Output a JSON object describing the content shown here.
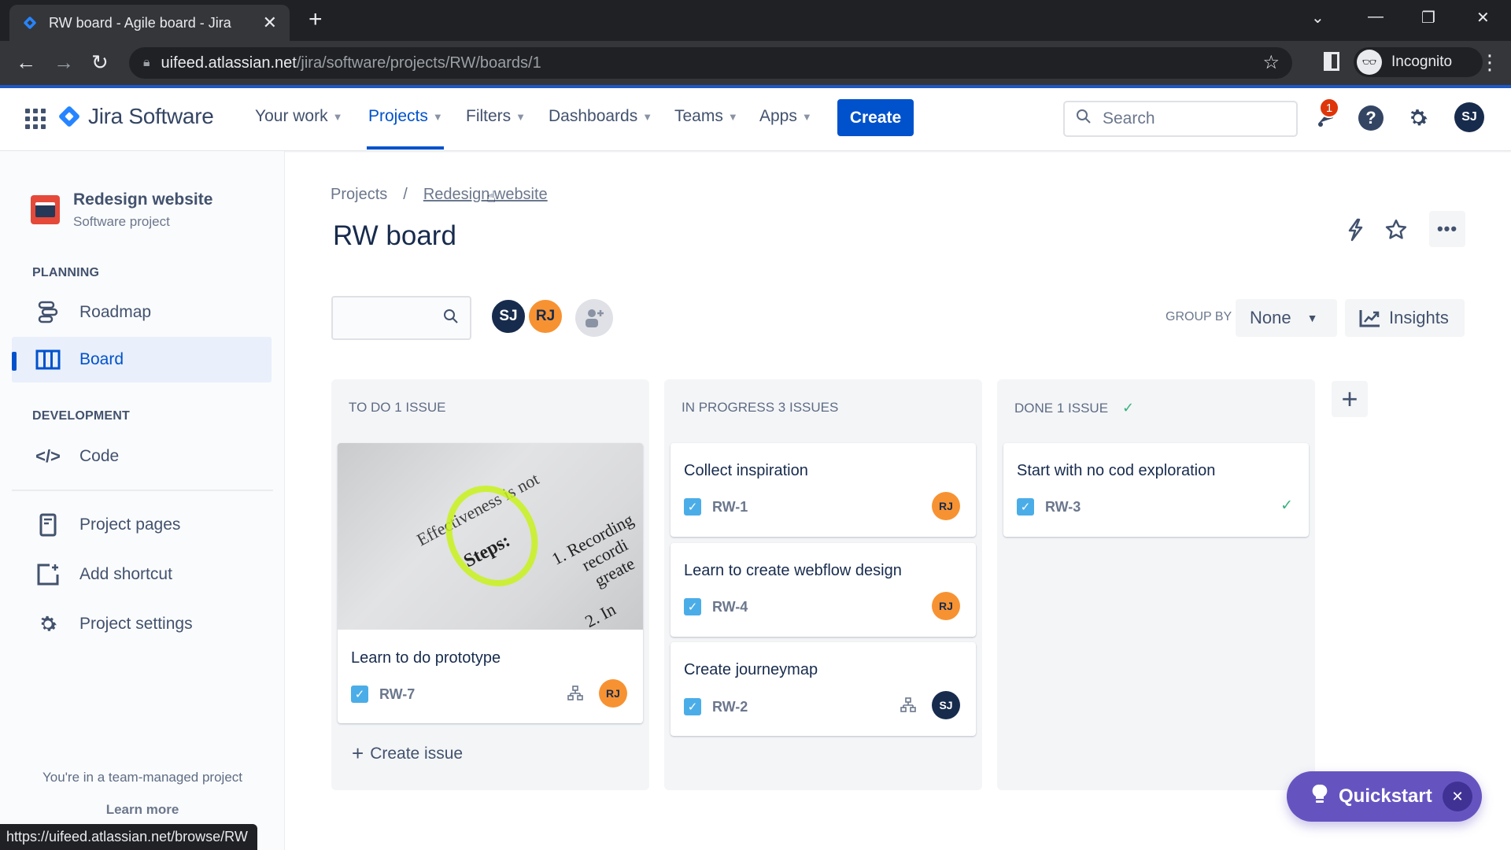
{
  "browser": {
    "tab_title": "RW board - Agile board - Jira",
    "url_host": "uifeed.atlassian.net",
    "url_path": "/jira/software/projects/RW/boards/1",
    "profile_label": "Incognito",
    "status_url": "https://uifeed.atlassian.net/browse/RW"
  },
  "topnav": {
    "product": "Jira Software",
    "items": [
      {
        "label": "Your work",
        "active": false
      },
      {
        "label": "Projects",
        "active": true
      },
      {
        "label": "Filters",
        "active": false
      },
      {
        "label": "Dashboards",
        "active": false
      },
      {
        "label": "Teams",
        "active": false
      },
      {
        "label": "Apps",
        "active": false
      }
    ],
    "create_label": "Create",
    "search_placeholder": "Search",
    "notification_count": "1",
    "user_initials": "SJ"
  },
  "sidebar": {
    "project_name": "Redesign website",
    "project_type": "Software project",
    "planning_heading": "PLANNING",
    "development_heading": "DEVELOPMENT",
    "items": [
      {
        "label": "Roadmap",
        "icon": "roadmap-icon"
      },
      {
        "label": "Board",
        "icon": "board-icon",
        "active": true
      },
      {
        "label": "Code",
        "icon": "code-icon"
      },
      {
        "label": "Project pages",
        "icon": "pages-icon"
      },
      {
        "label": "Add shortcut",
        "icon": "add-shortcut-icon"
      },
      {
        "label": "Project settings",
        "icon": "settings-icon"
      }
    ],
    "team_note": "You're in a team-managed project",
    "learn_more": "Learn more"
  },
  "main": {
    "breadcrumb": [
      "Projects",
      "Redesign website"
    ],
    "title": "RW board",
    "board_search_placeholder": "",
    "avatars": [
      "SJ",
      "RJ"
    ],
    "group_by_label": "GROUP BY",
    "group_by_value": "None",
    "insights_label": "Insights",
    "create_issue_label": "Create issue",
    "columns": [
      {
        "title": "TO DO 1 ISSUE",
        "cards": [
          {
            "summary": "Learn to do prototype",
            "key": "RW-7",
            "assignee": "RJ",
            "has_child": true,
            "cover_text": [
              "Effectiveness is not",
              "Steps:",
              "1. Recording",
              "recordi",
              "greate",
              "2. In"
            ]
          }
        ]
      },
      {
        "title": "IN PROGRESS 3 ISSUES",
        "cards": [
          {
            "summary": "Collect inspiration",
            "key": "RW-1",
            "assignee": "RJ"
          },
          {
            "summary": "Learn to create webflow design",
            "key": "RW-4",
            "assignee": "RJ"
          },
          {
            "summary": "Create journeymap",
            "key": "RW-2",
            "assignee": "SJ",
            "has_child": true
          }
        ]
      },
      {
        "title": "DONE 1 ISSUE",
        "cards": [
          {
            "summary": "Start with no cod exploration",
            "key": "RW-3",
            "done": true
          }
        ]
      }
    ]
  },
  "quickstart": {
    "label": "Quickstart"
  },
  "colors": {
    "brand": "#0052cc",
    "quickstart": "#6554c0",
    "avatar_sj": "#172b4d",
    "avatar_rj": "#f79232",
    "done_green": "#36b37e",
    "issue_checkbox": "#4bade8"
  }
}
